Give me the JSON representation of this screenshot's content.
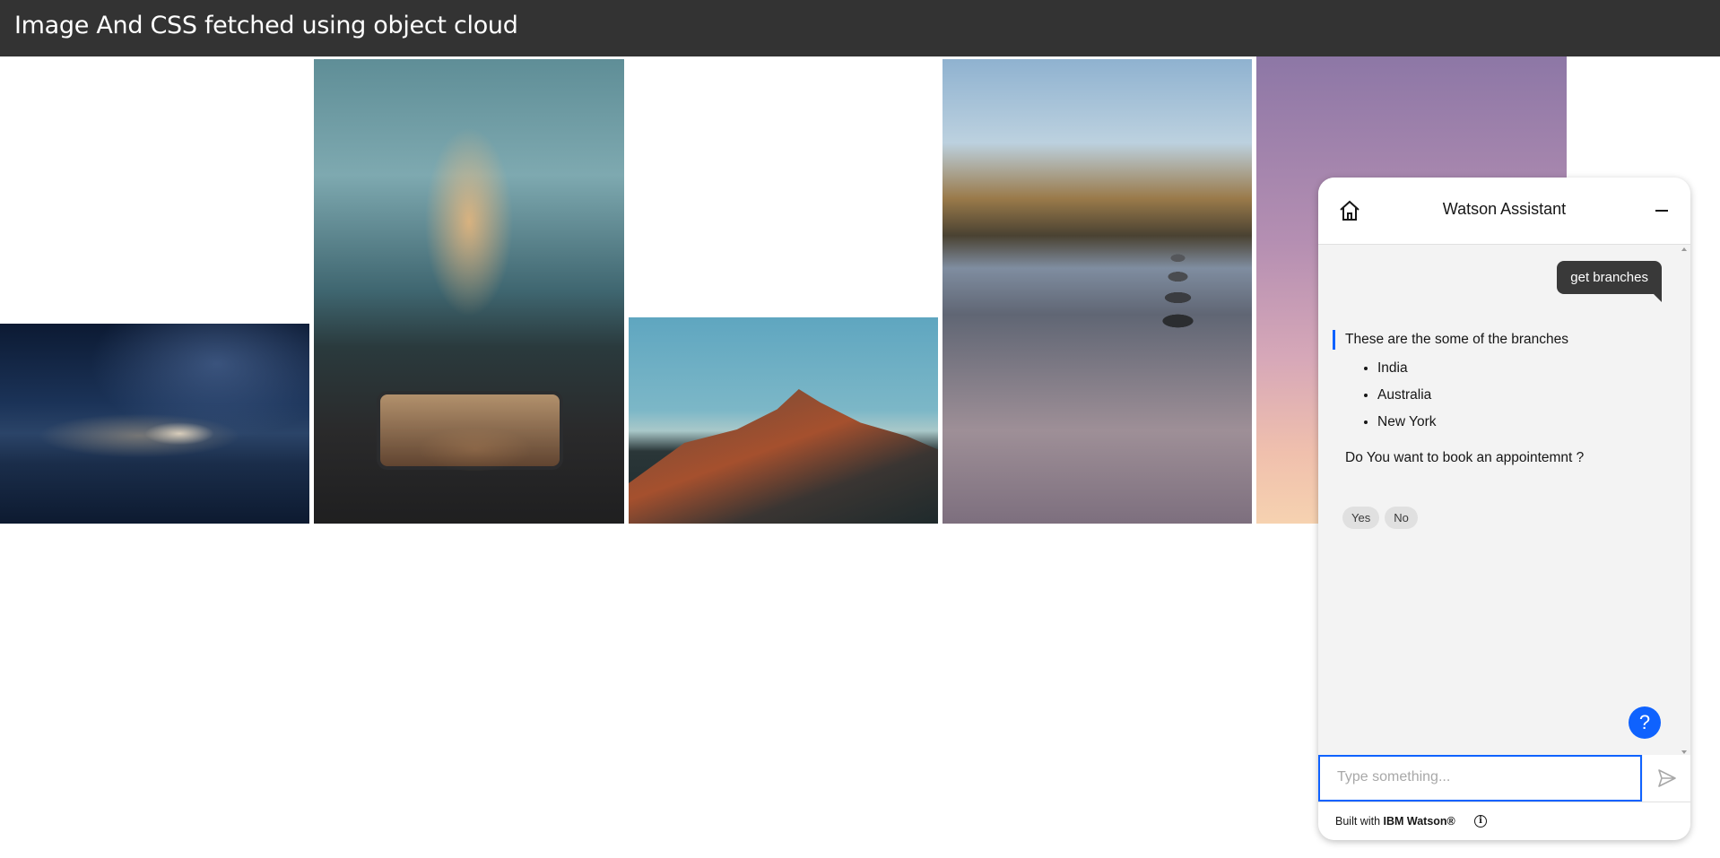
{
  "header": {
    "title": "Image And CSS fetched using object cloud"
  },
  "gallery": {
    "images": [
      {
        "subject": "night sky over water"
      },
      {
        "subject": "bokeh christmas tree"
      },
      {
        "subject": "mountain ridge at sunset"
      },
      {
        "subject": "stone cairn by lake"
      },
      {
        "subject": "pink purple sky"
      }
    ]
  },
  "assistant": {
    "title": "Watson Assistant",
    "user_message": "get branches",
    "bot_intro": "These are the some of the branches",
    "branches": [
      "India",
      "Australia",
      "New York"
    ],
    "bot_question": "Do You want to book an appointemnt ?",
    "options": [
      "Yes",
      "No"
    ],
    "help_label": "?",
    "input_placeholder": "Type something...",
    "footer_prefix": "Built with ",
    "footer_brand": "IBM Watson®",
    "accent_color": "#0f62fe"
  }
}
